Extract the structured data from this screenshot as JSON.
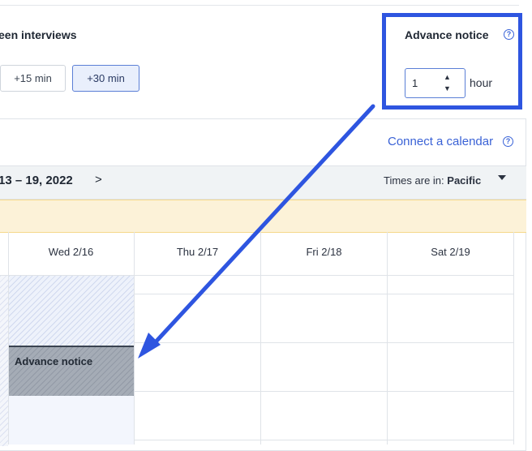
{
  "buffer": {
    "title": "een interviews",
    "options": [
      "+15 min",
      "+30 min"
    ],
    "selected": "+30 min"
  },
  "advance_notice": {
    "title": "Advance notice",
    "value": "1",
    "unit": "hour"
  },
  "calendar": {
    "connect_link": "Connect a calendar",
    "date_range": "13 – 19, 2022",
    "next_glyph": ">",
    "timezone_label": "Times are in:",
    "timezone_value": "Pacific",
    "days": [
      "Wed 2/16",
      "Thu 2/17",
      "Fri 2/18",
      "Sat 2/19"
    ],
    "advance_block_label": "Advance notice"
  },
  "annotation": {
    "highlight_color": "#2e55e0"
  },
  "icons": {
    "help": "?",
    "spinner_up": "▲",
    "spinner_down": "▼"
  }
}
